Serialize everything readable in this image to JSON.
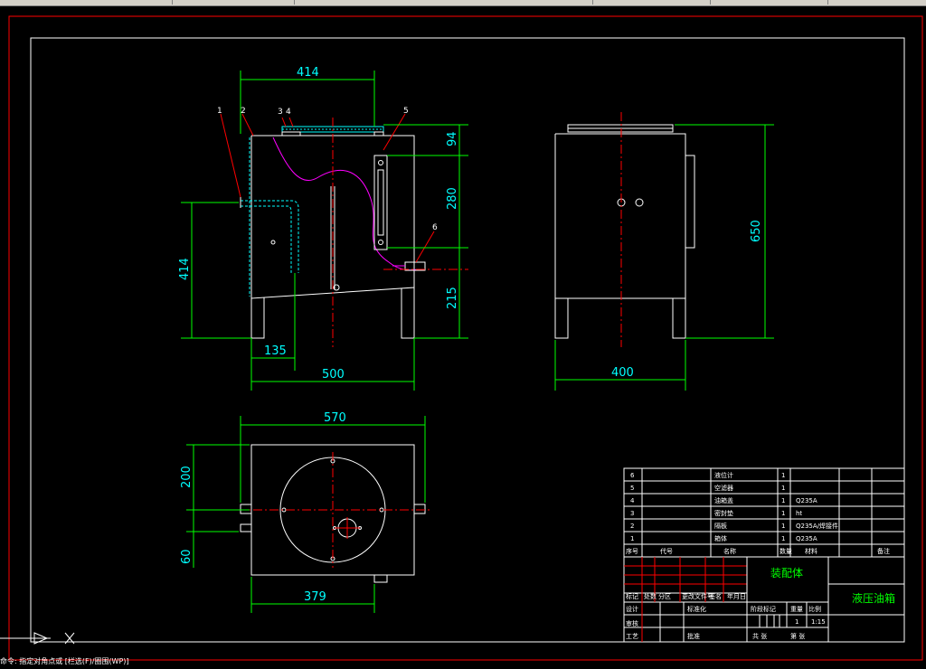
{
  "toolbar": {
    "visible": true
  },
  "drawing": {
    "front_view": {
      "dim_top_width": "414",
      "dim_left_height": "414",
      "dim_135": "135",
      "dim_500": "500",
      "dim_94": "94",
      "dim_280": "280",
      "dim_215": "215",
      "balloons": [
        "1",
        "2",
        "3",
        "4",
        "5",
        "6"
      ]
    },
    "side_view": {
      "dim_height": "650",
      "dim_width": "400"
    },
    "top_view": {
      "dim_570": "570",
      "dim_200": "200",
      "dim_60": "60",
      "dim_379": "379"
    }
  },
  "bom": {
    "rows": [
      {
        "no": "6",
        "name": "液位计",
        "qty": "1",
        "material": ""
      },
      {
        "no": "5",
        "name": "空滤器",
        "qty": "1",
        "material": ""
      },
      {
        "no": "4",
        "name": "油箱盖",
        "qty": "1",
        "material": "Q235A"
      },
      {
        "no": "3",
        "name": "密封垫",
        "qty": "1",
        "material": "ht"
      },
      {
        "no": "2",
        "name": "隔板",
        "qty": "1",
        "material": "Q235A/焊接件"
      },
      {
        "no": "1",
        "name": "箱体",
        "qty": "1",
        "material": "Q235A"
      }
    ],
    "header": [
      "序号",
      "代号",
      "名称",
      "数量",
      "材料",
      "备注"
    ]
  },
  "title_block": {
    "assembly_label": "装配体",
    "drawing_name": "液压油箱",
    "scale": "1:15",
    "qty": "1",
    "row_labels": [
      "标记",
      "处数",
      "分区",
      "更改文件号",
      "签名",
      "年月日"
    ],
    "left_labels": [
      "设计",
      "审核",
      "工艺"
    ],
    "stage_label": "阶段标记",
    "weight_label": "重量",
    "scale_label": "比例",
    "std_label": "标准化",
    "approve_label": "批准",
    "sheet_left": "共 张",
    "sheet_right": "第 张"
  },
  "command_line": "命令: 指定对角点或 [栏选(F)/圈围(WP)]"
}
